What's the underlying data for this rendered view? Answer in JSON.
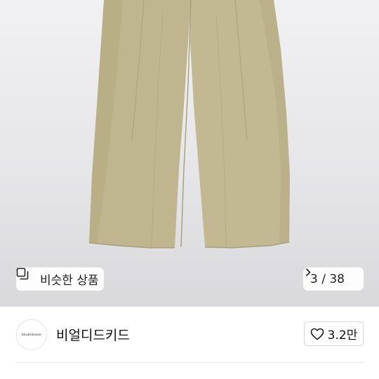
{
  "product_image": {
    "similar_products_label": "비슷한 상품",
    "page_counter": "3 / 38",
    "colors": {
      "pants": "#bfb590",
      "background": "#e8e8ea"
    }
  },
  "shop": {
    "name": "비얼디드키드",
    "avatar_text": "BEARDEDKID",
    "like_count": "3.2만"
  },
  "icons": {
    "similar": "similar-items-icon",
    "next": "chevron-right-icon",
    "like": "heart-outline-icon"
  }
}
